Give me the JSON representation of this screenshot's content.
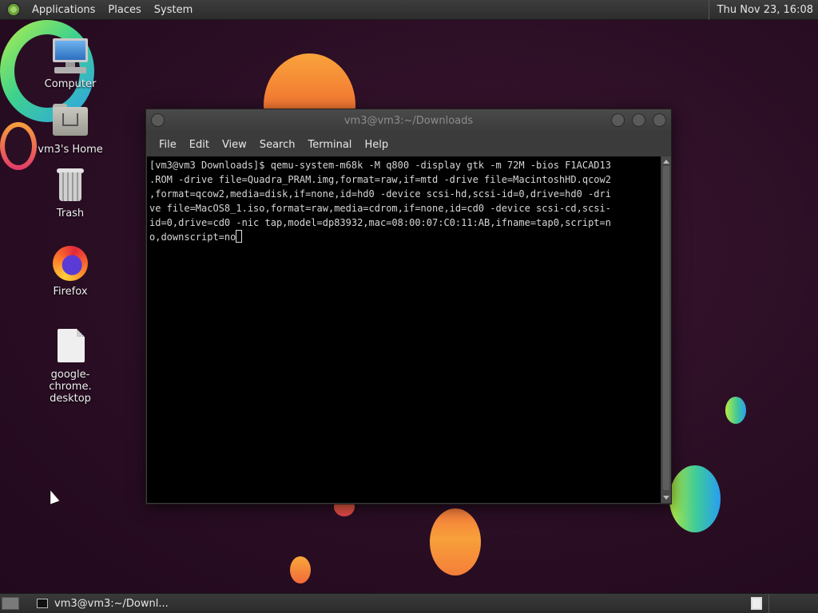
{
  "top_panel": {
    "menus": [
      "Applications",
      "Places",
      "System"
    ],
    "clock": "Thu Nov 23, 16:08"
  },
  "desktop_icons": [
    {
      "label": "Computer",
      "icon": "computer-icon"
    },
    {
      "label": "vm3's Home",
      "icon": "home-folder-icon"
    },
    {
      "label": "Trash",
      "icon": "trash-icon"
    },
    {
      "label": "Firefox",
      "icon": "firefox-icon"
    },
    {
      "label": "google-chrome.\ndesktop",
      "icon": "desktop-file-icon"
    }
  ],
  "terminal": {
    "title": "vm3@vm3:~/Downloads",
    "menu": [
      "File",
      "Edit",
      "View",
      "Search",
      "Terminal",
      "Help"
    ],
    "lines": [
      "[vm3@vm3 Downloads]$ qemu-system-m68k -M q800 -display gtk -m 72M -bios F1ACAD13",
      ".ROM -drive file=Quadra_PRAM.img,format=raw,if=mtd -drive file=MacintoshHD.qcow2",
      ",format=qcow2,media=disk,if=none,id=hd0 -device scsi-hd,scsi-id=0,drive=hd0 -dri",
      "ve file=MacOS8_1.iso,format=raw,media=cdrom,if=none,id=cd0 -device scsi-cd,scsi-",
      "id=0,drive=cd0 -nic tap,model=dp83932,mac=08:00:07:C0:11:AB,ifname=tap0,script=n",
      "o,downscript=no"
    ]
  },
  "bottom_panel": {
    "task_label": "vm3@vm3:~/Downl..."
  }
}
